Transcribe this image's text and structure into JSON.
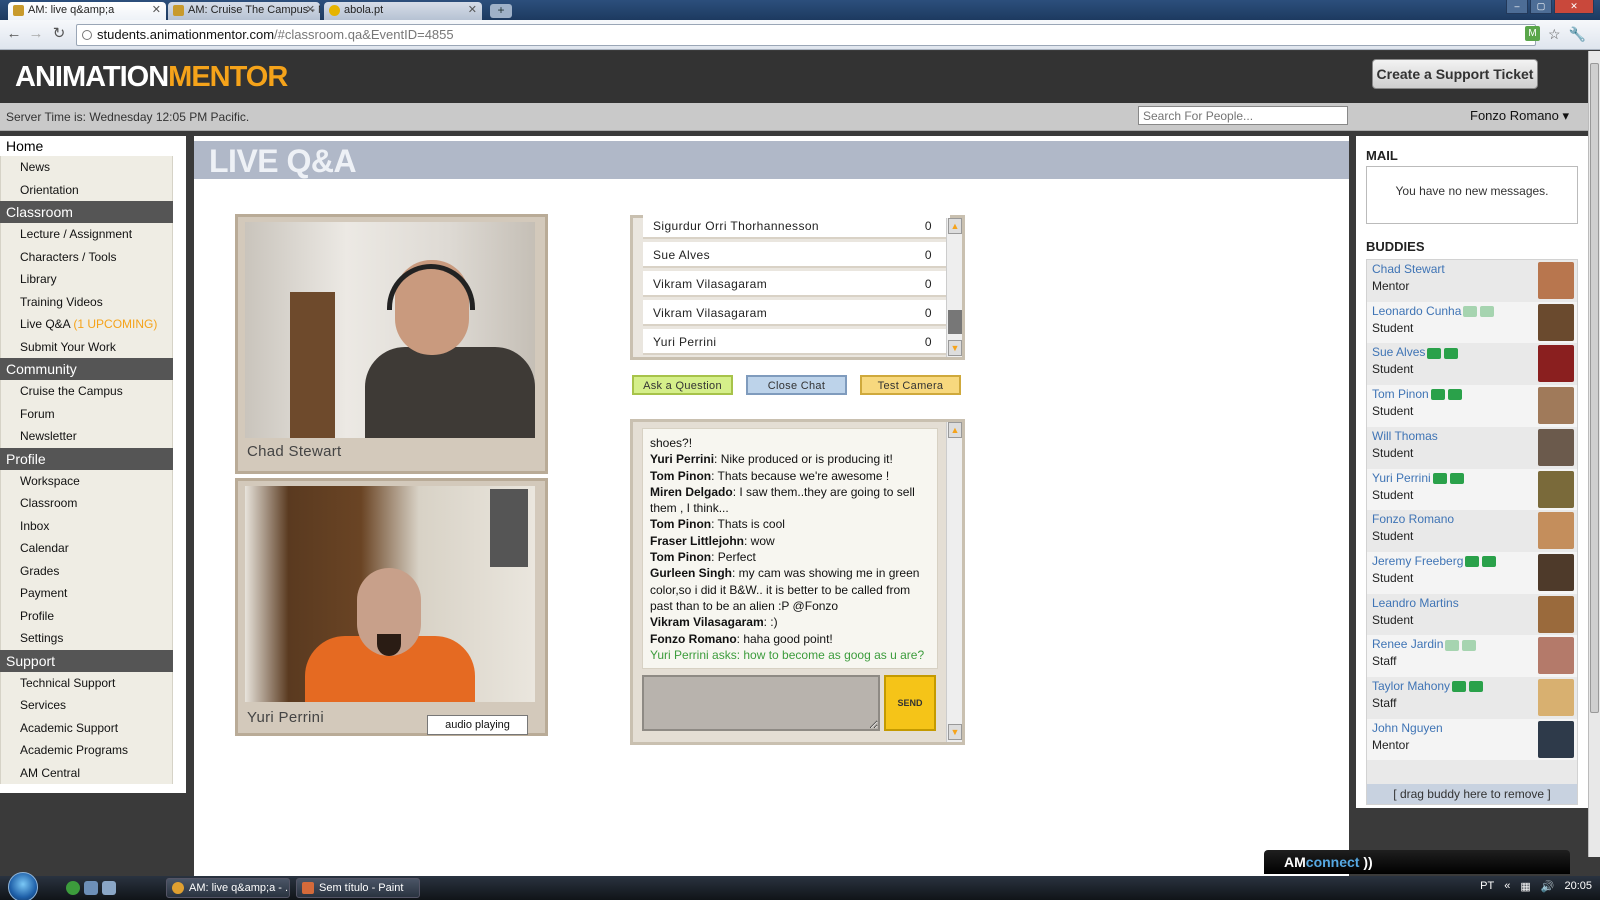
{
  "browser": {
    "tabs": [
      {
        "title": "AM: live q&amp;a",
        "active": true
      },
      {
        "title": "AM: Cruise The Campus - M",
        "active": false
      },
      {
        "title": "abola.pt",
        "active": false
      }
    ],
    "url_host": "students.animationmentor.com",
    "url_path": "/#classroom.qa&EventID=4855"
  },
  "header": {
    "logo_part1": "ANIMATION",
    "logo_part2": "MENTOR",
    "support_button": "Create a Support Ticket",
    "server_time": "Server Time is: Wednesday 12:05 PM Pacific.",
    "search_placeholder": "Search For People...",
    "user_name": "Fonzo Romano"
  },
  "nav": {
    "home": "Home",
    "sections": [
      {
        "label": "Classroom",
        "items": [
          "Lecture / Assignment",
          "Characters / Tools",
          "Library",
          "Training Videos",
          "Live Q&A",
          "Submit Your Work"
        ]
      },
      {
        "label": "Community",
        "items": [
          "Cruise the Campus",
          "Forum",
          "Newsletter"
        ]
      },
      {
        "label": "Profile",
        "items": [
          "Workspace",
          "Classroom",
          "Inbox",
          "Calendar",
          "Grades",
          "Payment",
          "Profile",
          "Settings"
        ]
      },
      {
        "label": "Support",
        "items": [
          "Technical Support",
          "Services",
          "Academic Support",
          "Academic Programs",
          "AM Central"
        ]
      }
    ],
    "home_items": [
      "News",
      "Orientation"
    ],
    "upcoming_badge": "(1 UPCOMING)"
  },
  "main": {
    "title": "LIVE Q&A",
    "cams": [
      {
        "name": "Chad Stewart"
      },
      {
        "name": "Yuri Perrini",
        "audio_label": "audio playing"
      }
    ],
    "queue": [
      {
        "name": "Sigurdur Orri Thorhannesson",
        "count": "0"
      },
      {
        "name": "Sue Alves",
        "count": "0"
      },
      {
        "name": "Vikram Vilasagaram",
        "count": "0"
      },
      {
        "name": "Vikram Vilasagaram",
        "count": "0"
      },
      {
        "name": "Yuri Perrini",
        "count": "0"
      }
    ],
    "buttons": {
      "ask": "Ask a Question",
      "close": "Close Chat",
      "test": "Test Camera",
      "send": "SEND"
    },
    "chat": [
      {
        "speaker": "",
        "text": "shoes?!"
      },
      {
        "speaker": "Yuri Perrini",
        "text": ": Nike produced or is producing it!"
      },
      {
        "speaker": "Tom Pinon",
        "text": ": Thats because we're awesome !"
      },
      {
        "speaker": "Miren Delgado",
        "text": ": I saw them..they are going to sell them , I think..."
      },
      {
        "speaker": "Tom Pinon",
        "text": ": Thats is cool"
      },
      {
        "speaker": "Fraser Littlejohn",
        "text": ": wow"
      },
      {
        "speaker": "Tom Pinon",
        "text": ": Perfect"
      },
      {
        "speaker": "Gurleen Singh",
        "text": ": my cam was showing me in green color,so i did it B&W.. it is better to be called from past than to be an alien :P @Fonzo"
      },
      {
        "speaker": "Vikram Vilasagaram",
        "text": ": :)"
      },
      {
        "speaker": "Fonzo Romano",
        "text": ": haha good point!"
      }
    ],
    "chat_question": "Yuri Perrini asks: how to become as goog as u are?"
  },
  "sidebar": {
    "mail_title": "MAIL",
    "mail_message": "You have no new messages.",
    "buddies_title": "BUDDIES",
    "buddies": [
      {
        "name": "Chad Stewart",
        "role": "Mentor",
        "icons": "none",
        "avatar": "#b8764e"
      },
      {
        "name": "Leonardo Cunha",
        "role": "Student",
        "icons": "off",
        "avatar": "#6a4a2e"
      },
      {
        "name": "Sue Alves",
        "role": "Student",
        "icons": "on",
        "avatar": "#8a1f1f"
      },
      {
        "name": "Tom Pinon",
        "role": "Student",
        "icons": "on",
        "avatar": "#a07a5a"
      },
      {
        "name": "Will Thomas",
        "role": "Student",
        "icons": "none",
        "avatar": "#6b5a4c"
      },
      {
        "name": "Yuri Perrini",
        "role": "Student",
        "icons": "on",
        "avatar": "#7a6a3a"
      },
      {
        "name": "Fonzo Romano",
        "role": "Student",
        "icons": "none",
        "avatar": "#c48e5c"
      },
      {
        "name": "Jeremy Freeberg",
        "role": "Student",
        "icons": "on",
        "avatar": "#4e3a2a"
      },
      {
        "name": "Leandro Martins",
        "role": "Student",
        "icons": "none",
        "avatar": "#9a6a3c"
      },
      {
        "name": "Renee Jardin",
        "role": "Staff",
        "icons": "off",
        "avatar": "#b47a6a"
      },
      {
        "name": "Taylor Mahony",
        "role": "Staff",
        "icons": "on",
        "avatar": "#d8b070"
      },
      {
        "name": "John Nguyen",
        "role": "Mentor",
        "icons": "none",
        "avatar": "#2e3a4a"
      }
    ],
    "drag_note": "[ drag buddy here to remove ]"
  },
  "amconnect": {
    "part1": "AM",
    "part2": "connect"
  },
  "taskbar": {
    "tasks": [
      "AM: live q&amp;a - ...",
      "Sem título - Paint"
    ],
    "lang": "PT",
    "time": "20:05"
  }
}
